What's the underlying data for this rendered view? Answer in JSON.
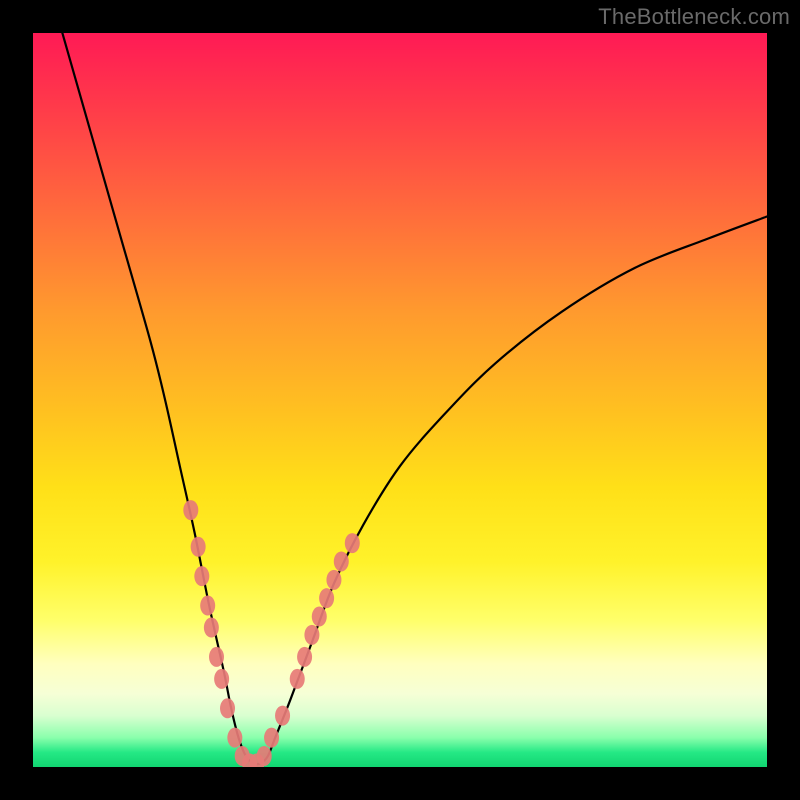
{
  "watermark": "TheBottleneck.com",
  "colors": {
    "background_black": "#000000",
    "curve_black": "#000000",
    "marker_fill": "#e77b77",
    "gradient_top": "#ff1a55",
    "gradient_bottom": "#11d571"
  },
  "chart_data": {
    "type": "line",
    "title": "",
    "xlabel": "",
    "ylabel": "",
    "xlim": [
      0,
      100
    ],
    "ylim": [
      0,
      100
    ],
    "grid": false,
    "note": "V-shaped bottleneck curve on a red-to-green heat gradient. x is relative component balance (0–100), y is bottleneck severity 0 (none) to 100 (max). Values are estimated from the image since axes are unlabeled.",
    "series": [
      {
        "name": "bottleneck_curve",
        "x": [
          0,
          4,
          8,
          12,
          16,
          18,
          20,
          22,
          24,
          26,
          27,
          28,
          29,
          30,
          31,
          32,
          33,
          35,
          38,
          41,
          45,
          50,
          56,
          63,
          72,
          82,
          92,
          100
        ],
        "y": [
          114,
          100,
          86,
          72,
          58,
          50,
          41,
          32,
          22,
          13,
          8,
          4,
          1.5,
          0.5,
          0.5,
          1.5,
          4,
          9,
          17,
          25,
          33,
          41,
          48,
          55,
          62,
          68,
          72,
          75
        ]
      }
    ],
    "markers": {
      "name": "highlighted_points",
      "note": "Dense salmon dots clustered around the minimum of the V.",
      "points": [
        {
          "x": 21.5,
          "y": 35
        },
        {
          "x": 22.5,
          "y": 30
        },
        {
          "x": 23.0,
          "y": 26
        },
        {
          "x": 23.8,
          "y": 22
        },
        {
          "x": 24.3,
          "y": 19
        },
        {
          "x": 25.0,
          "y": 15
        },
        {
          "x": 25.7,
          "y": 12
        },
        {
          "x": 26.5,
          "y": 8
        },
        {
          "x": 27.5,
          "y": 4
        },
        {
          "x": 28.5,
          "y": 1.5
        },
        {
          "x": 29.5,
          "y": 0.5
        },
        {
          "x": 30.5,
          "y": 0.5
        },
        {
          "x": 31.5,
          "y": 1.5
        },
        {
          "x": 32.5,
          "y": 4
        },
        {
          "x": 34.0,
          "y": 7
        },
        {
          "x": 36.0,
          "y": 12
        },
        {
          "x": 37.0,
          "y": 15
        },
        {
          "x": 38.0,
          "y": 18
        },
        {
          "x": 39.0,
          "y": 20.5
        },
        {
          "x": 40.0,
          "y": 23
        },
        {
          "x": 41.0,
          "y": 25.5
        },
        {
          "x": 42.0,
          "y": 28
        },
        {
          "x": 43.5,
          "y": 30.5
        }
      ]
    }
  }
}
